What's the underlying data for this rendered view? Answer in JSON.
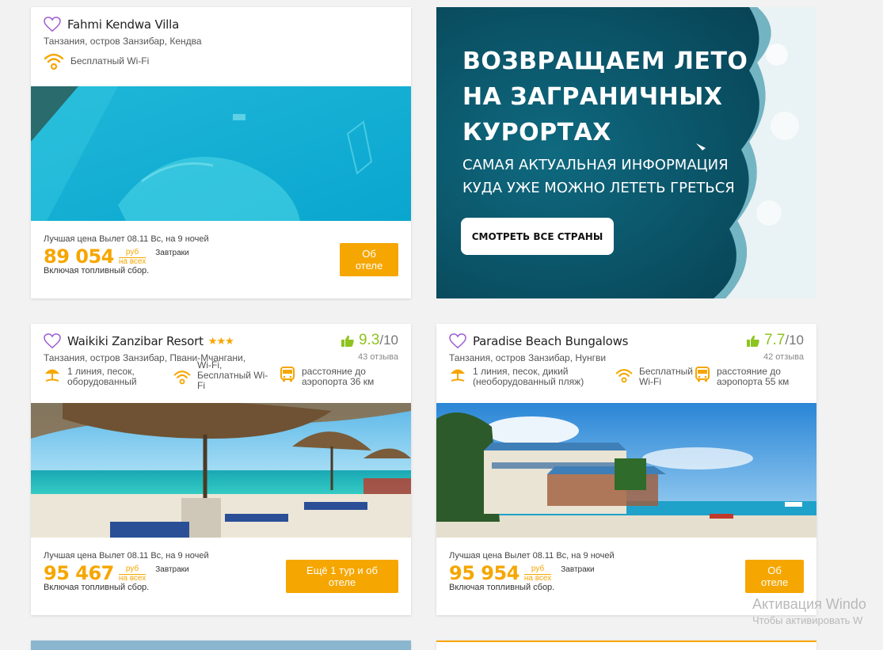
{
  "colors": {
    "accent": "#f6a600",
    "rating": "#8fc31f",
    "heart": "#9b59d0",
    "promo_bg": "#0b4a5c"
  },
  "cards": [
    {
      "name": "Fahmi Kendwa Villa",
      "stars": "",
      "location": "Танзания, остров Занзибар, Кендва",
      "features": [
        "Бесплатный Wi-Fi"
      ],
      "price_caption": "Лучшая цена Вылет 08.11 Вс, на 9 ночей",
      "price": "89 054",
      "currency_top": "руб",
      "currency_bottom": "на всех",
      "meal": "Завтраки",
      "fuel_note": "Включая топливный сбор.",
      "button": "Об отеле"
    },
    {
      "name": "Waikiki Zanzibar Resort",
      "stars": "★★★",
      "score": "9.3",
      "score_max": "/10",
      "reviews": "43 отзыва",
      "location": "Танзания, остров Занзибар, Пвани-Мчангани,",
      "features": [
        "1 линия, песок, оборудованный",
        "Wi-Fi, Бесплатный Wi-Fi",
        "расстояние до аэропорта 36 км"
      ],
      "price_caption": "Лучшая цена Вылет 08.11 Вс, на 9 ночей",
      "price": "95 467",
      "currency_top": "руб",
      "currency_bottom": "на всех",
      "meal": "Завтраки",
      "fuel_note": "Включая топливный сбор.",
      "button": "Ещё 1 тур и об отеле"
    },
    {
      "name": "Paradise Beach Bungalows",
      "stars": "",
      "score": "7.7",
      "score_max": "/10",
      "reviews": "42 отзыва",
      "location": "Танзания, остров Занзибар, Нунгви",
      "features": [
        "1 линия, песок, дикий (необорудованный пляж)",
        "Бесплатный Wi-Fi",
        "расстояние до аэропорта 55 км"
      ],
      "price_caption": "Лучшая цена Вылет 08.11 Вс, на 9 ночей",
      "price": "95 954",
      "currency_top": "руб",
      "currency_bottom": "на всех",
      "meal": "Завтраки",
      "fuel_note": "Включая топливный сбор.",
      "button": "Об отеле"
    }
  ],
  "promo": {
    "title_lines": [
      "ВОЗВРАЩАЕМ ЛЕТО",
      "НА ЗАГРАНИЧНЫХ",
      "КУРОРТАХ"
    ],
    "subtitle_lines": [
      "САМАЯ АКТУАЛЬНАЯ ИНФОРМАЦИЯ",
      "КУДА УЖЕ МОЖНО ЛЕТЕТЬ ГРЕТЬСЯ"
    ],
    "button": "СМОТРЕТЬ ВСЕ СТРАНЫ"
  },
  "watermark": {
    "line1": "Активация Windo",
    "line2": "Чтобы активировать W"
  }
}
